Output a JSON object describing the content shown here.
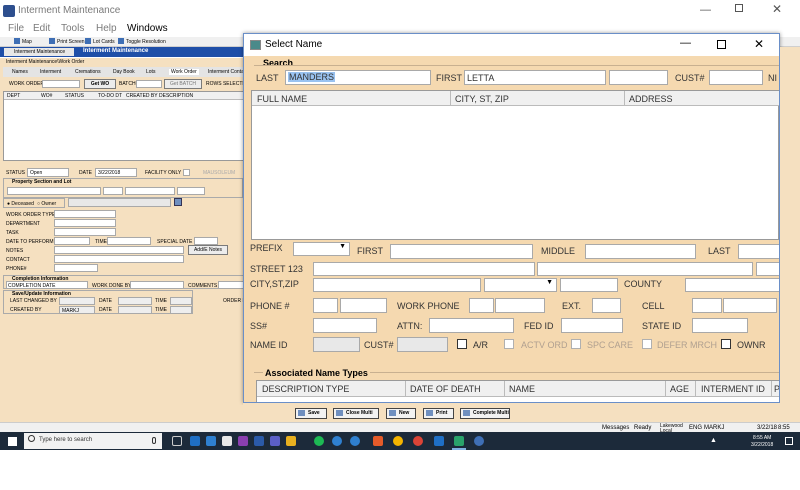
{
  "window": {
    "title": "Interment Maintenance",
    "menu": [
      "File",
      "Edit",
      "Tools",
      "Help",
      "Windows"
    ]
  },
  "toolbar": [
    "Map",
    "Print Screen",
    "Lot Cards",
    "Toggle Resolution"
  ],
  "nav": {
    "tab_label": "Interment Maintenance",
    "header_title": "Interment Maintenance",
    "breadcrumb": "Interment Maintenance\\Work Order"
  },
  "subtabs": [
    "Names",
    "Interment",
    "Cremations",
    "Day Book",
    "Lots",
    "Work Order",
    "Interment Contact"
  ],
  "workorder": {
    "wo_label": "WORK ORDER#",
    "get_wo": "Get WO",
    "batch_label": "BATCH#",
    "get_batch": "Get BATCH",
    "rows_selected": "ROWS SELECTED",
    "columns": [
      "DEPT",
      "WO#",
      "STATUS",
      "TO-DO DT",
      "CREATED BY",
      "DESCRIPTION"
    ]
  },
  "form": {
    "status_label": "STATUS",
    "status_value": "Open",
    "date_label": "DATE",
    "date_value": "3/22/2018",
    "facility_only": "FACILITY ONLY",
    "mausoleum": "MAUSOLEUM",
    "property_section": "Property Section and Lot",
    "deceased": "Deceased",
    "owner": "Owner",
    "work_order_type": "WORK ORDER TYPE",
    "department": "DEPARTMENT",
    "task": "TASK",
    "date_to_perform": "DATE TO PERFORM",
    "time": "TIME",
    "special_date": "SPECIAL DATE",
    "notes": "NOTES",
    "add_notes": "Add/E Notes",
    "contact": "CONTACT",
    "phone": "PHONE#",
    "completion_info": "Completion Information",
    "completion_date": "COMPLETION DATE",
    "work_done_by": "WORK DONE BY",
    "comments": "COMMENTS",
    "save_update_info": "Save/Update Information",
    "last_changed_by": "LAST CHANGED BY",
    "created_by": "CREATED BY",
    "created_by_value": "MARKJ",
    "date": "DATE",
    "time2": "TIME",
    "order_r": "ORDER R"
  },
  "dialog": {
    "title": "Select Name",
    "search_label": "Search",
    "last_label": "LAST",
    "last_value": "MANDERS",
    "first_label": "FIRST",
    "first_value": "LETTA",
    "cust_label": "CUST#",
    "ni_label": "NI",
    "results_columns": [
      "FULL NAME",
      "CITY, ST, ZIP",
      "ADDRESS"
    ],
    "prefix": "PREFIX",
    "first": "FIRST",
    "middle": "MIDDLE",
    "last": "LAST",
    "street": "STREET 123",
    "city_st_zip": "CITY,ST,ZIP",
    "county": "COUNTY",
    "phone": "PHONE #",
    "work_phone": "WORK PHONE",
    "ext": "EXT.",
    "cell": "CELL",
    "ss": "SS#",
    "attn": "ATTN:",
    "fed_id": "FED ID",
    "state_id": "STATE ID",
    "name_id": "NAME ID",
    "cust": "CUST#",
    "ar": "A/R",
    "actv_ord": "ACTV ORD",
    "spc_care": "SPC CARE",
    "defer_mrch": "DEFER MRCH",
    "ownr": "OWNR",
    "assoc_title": "Associated Name Types",
    "assoc_columns": [
      "DESCRIPTION TYPE",
      "DATE OF DEATH",
      "NAME",
      "AGE",
      "INTERMENT ID",
      "P"
    ]
  },
  "bottom_buttons": [
    "Save",
    "Close Multi",
    "New",
    "Print",
    "Complete Multi"
  ],
  "statusbar": {
    "messages": "Messages",
    "ready": "Ready",
    "location": "Lakewood Local",
    "lang": "ENG",
    "user": "MARKJ",
    "date": "3/22/18",
    "time": "8:55"
  },
  "taskbar": {
    "search": "Type here to search",
    "time": "8:55 AM",
    "date": "3/22/2018"
  }
}
